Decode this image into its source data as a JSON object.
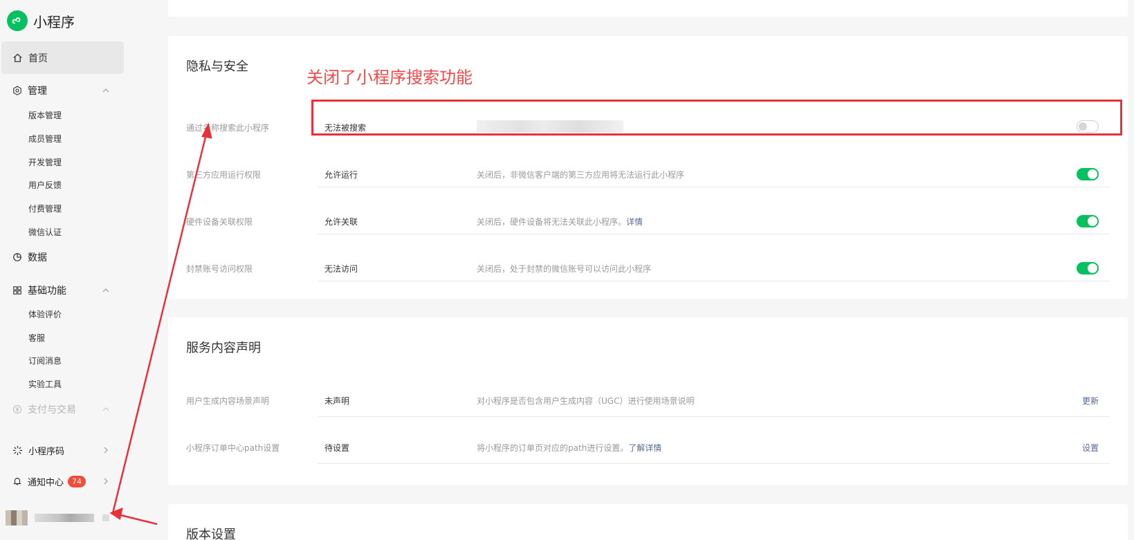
{
  "sidebar": {
    "brand": "小程序",
    "home": "首页",
    "manage": {
      "label": "管理",
      "items": [
        "版本管理",
        "成员管理",
        "开发管理",
        "用户反馈",
        "付费管理",
        "微信认证"
      ]
    },
    "data": "数据",
    "basic": {
      "label": "基础功能",
      "items": [
        "体验评价",
        "客服",
        "订阅消息",
        "实验工具"
      ]
    },
    "payment": "支付与交易",
    "qrcode": "小程序码",
    "notify": {
      "label": "通知中心",
      "badge": "74"
    }
  },
  "privacy": {
    "title": "隐私与安全",
    "rows": [
      {
        "label": "通过名称搜索此小程序",
        "status": "无法被搜索",
        "desc": "",
        "toggle": "off"
      },
      {
        "label": "第三方应用运行权限",
        "status": "允许运行",
        "desc": "关闭后，非微信客户端的第三方应用将无法运行此小程序",
        "toggle": "on"
      },
      {
        "label": "硬件设备关联权限",
        "status": "允许关联",
        "desc": "关闭后，硬件设备将无法关联此小程序。",
        "link": "详情",
        "toggle": "on"
      },
      {
        "label": "封禁账号访问权限",
        "status": "无法访问",
        "desc": "关闭后，处于封禁的微信账号可以访问此小程序",
        "toggle": "on"
      }
    ]
  },
  "service": {
    "title": "服务内容声明",
    "rows": [
      {
        "label": "用户生成内容场景声明",
        "status": "未声明",
        "desc": "对小程序是否包含用户生成内容（UGC）进行使用场景说明",
        "action": "更新"
      },
      {
        "label": "小程序订单中心path设置",
        "status": "待设置",
        "desc": "将小程序的订单页对应的path进行设置。",
        "link": "了解详情",
        "action": "设置"
      }
    ]
  },
  "version": {
    "title": "版本设置"
  },
  "annotation": {
    "text": "关闭了小程序搜索功能",
    "color": "#f24a4a"
  },
  "colors": {
    "accent": "#07c160",
    "link": "#576b95",
    "badge": "#f04d3a"
  }
}
